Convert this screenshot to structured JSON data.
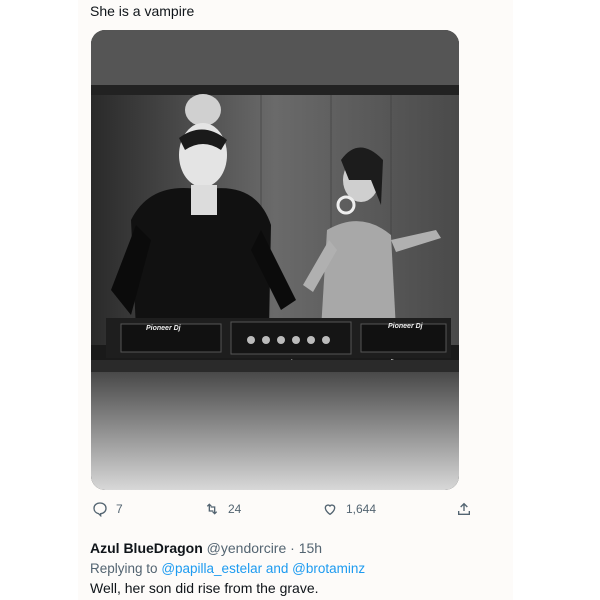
{
  "tweet": {
    "text": "She is a vampire",
    "image_alt": "Black and white photo of two women DJing behind Pioneer DJ decks",
    "deck_brand_left": "Pioneer Dj",
    "deck_brand_right": "Pioneer Dj",
    "actions": {
      "reply_count": "7",
      "retweet_count": "24",
      "like_count": "1,644"
    }
  },
  "reply": {
    "name": "Azul BlueDragon",
    "handle": "@yendorcire",
    "separator": "·",
    "time": "15h",
    "replying_prefix": "Replying to",
    "mention_1": "@papilla_estelar",
    "and_word": "and",
    "mention_2": "@brotaminz",
    "text": "Well, her son did rise from the grave."
  },
  "colors": {
    "text_primary": "#0f1419",
    "text_secondary": "#536471",
    "link": "#1d9bf0"
  }
}
